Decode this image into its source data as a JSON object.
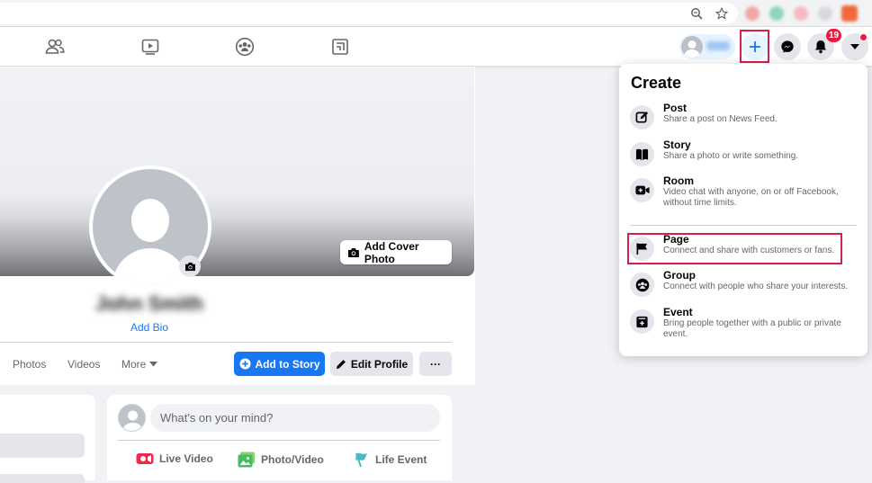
{
  "header": {
    "notification_count": "19"
  },
  "profile": {
    "add_cover_label": "Add Cover Photo",
    "name": "John Smith",
    "add_bio_label": "Add Bio",
    "tabs": [
      "Photos",
      "Videos",
      "More"
    ],
    "add_story_label": "Add to Story",
    "edit_profile_label": "Edit Profile",
    "more_actions_label": "···"
  },
  "composer": {
    "placeholder": "What's on your mind?",
    "actions": [
      "Live Video",
      "Photo/Video",
      "Life Event"
    ]
  },
  "create_menu": {
    "title": "Create",
    "items": [
      {
        "label": "Post",
        "description": "Share a post on News Feed.",
        "icon": "compose-icon"
      },
      {
        "label": "Story",
        "description": "Share a photo or write something.",
        "icon": "book-icon"
      },
      {
        "label": "Room",
        "description": "Video chat with anyone, on or off Facebook, without time limits.",
        "icon": "video-camera-icon"
      },
      {
        "label": "Page",
        "description": "Connect and share with customers or fans.",
        "icon": "flag-icon"
      },
      {
        "label": "Group",
        "description": "Connect with people who share your interests.",
        "icon": "group-icon"
      },
      {
        "label": "Event",
        "description": "Bring people together with a public or private event.",
        "icon": "calendar-icon"
      }
    ]
  },
  "colors": {
    "facebook_blue": "#1877f2",
    "highlight_red": "#d61f4b",
    "badge_red": "#e41e3f"
  }
}
